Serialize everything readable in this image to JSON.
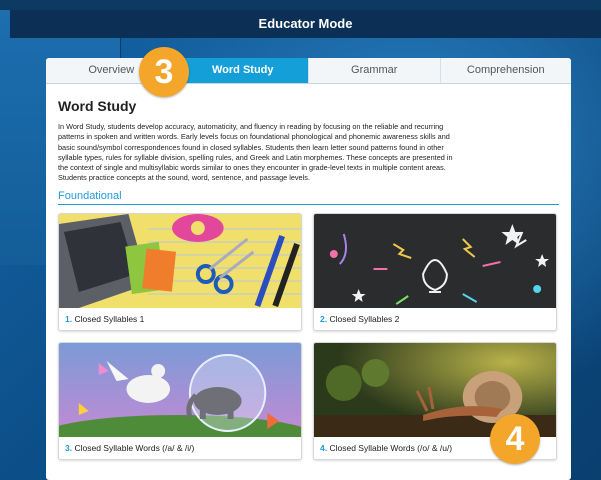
{
  "header": {
    "title": "Educator Mode"
  },
  "tabs": [
    {
      "label": "Overview",
      "active": false
    },
    {
      "label": "Word Study",
      "active": true
    },
    {
      "label": "Grammar",
      "active": false
    },
    {
      "label": "Comprehension",
      "active": false
    }
  ],
  "main": {
    "title": "Word Study",
    "description": "In Word Study, students develop accuracy, automaticity, and fluency in reading by focusing on the reliable and recurring patterns in spoken and written words. Early levels focus on foundational phonological and phonemic awareness skills and basic sound/symbol correspondences found in closed syllables. Students then learn letter sound patterns found in other syllable types, rules for syllable division, spelling rules, and Greek and Latin morphemes. These concepts are presented in the context of single and multisyllabic words similar to ones they encounter in grade-level texts in multiple content areas. Students practice concepts at the sound, word, sentence, and passage levels.",
    "section": "Foundational",
    "lessons": [
      {
        "num": "1.",
        "label": "Closed Syllables 1"
      },
      {
        "num": "2.",
        "label": "Closed Syllables 2"
      },
      {
        "num": "3.",
        "label": "Closed Syllable Words (/a/ & /i/)"
      },
      {
        "num": "4.",
        "label": "Closed Syllable Words (/o/ & /u/)"
      }
    ]
  },
  "callouts": {
    "badge_3": "3",
    "badge_4": "4"
  },
  "colors": {
    "accent": "#159fd8",
    "badge": "#f4a62a",
    "header": "#0b2f55"
  }
}
